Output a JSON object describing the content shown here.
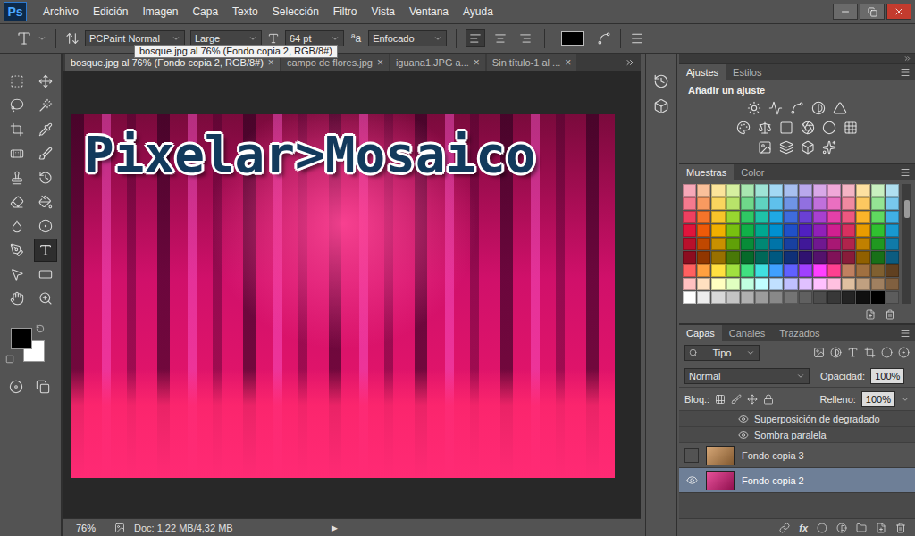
{
  "app": {
    "logo": "Ps"
  },
  "menu": [
    "Archivo",
    "Edición",
    "Imagen",
    "Capa",
    "Texto",
    "Selección",
    "Filtro",
    "Vista",
    "Ventana",
    "Ayuda"
  ],
  "options_bar": {
    "font_family": "PCPaint Normal",
    "font_style": "Large",
    "font_size": "64 pt",
    "antialias_icon": "ªa",
    "antialias": "Enfocado",
    "alignment": [
      {
        "selected": true
      },
      {
        "selected": false
      },
      {
        "selected": false
      }
    ],
    "text_color": "#000000"
  },
  "tooltip": "bosque.jpg al 76% (Fondo copia 2, RGB/8#)",
  "document_tabs": [
    {
      "label": "bosque.jpg al 76% (Fondo copia 2, RGB/8#)",
      "selected": true
    },
    {
      "label": "campo de flores.jpg",
      "selected": false
    },
    {
      "label": "iguana1.JPG a...",
      "selected": false
    },
    {
      "label": "Sin título-1 al ...",
      "selected": false
    }
  ],
  "tab_close": "×",
  "tools": [
    {
      "selected": false
    },
    {
      "selected": false
    },
    {
      "selected": false
    },
    {
      "selected": false
    },
    {
      "selected": false
    },
    {
      "selected": false
    },
    {
      "selected": false
    },
    {
      "selected": false
    },
    {
      "selected": false
    },
    {
      "selected": false
    },
    {
      "selected": false
    },
    {
      "selected": false
    },
    {
      "selected": false
    },
    {
      "selected": false
    },
    {
      "selected": false
    },
    {
      "selected": true
    },
    {
      "selected": false
    },
    {
      "selected": false
    },
    {
      "selected": false
    },
    {
      "selected": false
    }
  ],
  "colors": {
    "foreground": "#000000",
    "background": "#ffffff"
  },
  "canvas": {
    "text": "Pixelar>Mosaico"
  },
  "status_bar": {
    "zoom": "76%",
    "doc": "Doc: 1,22 MB/4,32 MB",
    "arrow": "▶"
  },
  "panels": {
    "adjustments": {
      "tabs": [
        {
          "label": "Ajustes",
          "selected": true
        },
        {
          "label": "Estilos",
          "selected": false
        }
      ],
      "title": "Añadir un ajuste"
    },
    "swatches": {
      "tabs": [
        {
          "label": "Muestras",
          "selected": true
        },
        {
          "label": "Color",
          "selected": false
        }
      ],
      "colors": [
        [
          "#f7a8b8",
          "#f9c09a",
          "#fbe49a",
          "#d6f0a0",
          "#a8e6b0",
          "#9fe3d6",
          "#a3d8f4",
          "#a8bff0",
          "#b9a8ec",
          "#d8a8e8",
          "#f0a8d8",
          "#f4b4c4",
          "#fde0a0",
          "#c8f0c0",
          "#b0e0f0"
        ],
        [
          "#f47a8e",
          "#f89a60",
          "#f9d55e",
          "#b8e36a",
          "#6fd88a",
          "#5fd3c0",
          "#5fc0ec",
          "#6f94e6",
          "#9170e0",
          "#c070dc",
          "#ea6fc0",
          "#f08aa0",
          "#fcc860",
          "#94e494",
          "#78c8ec"
        ],
        [
          "#ef4060",
          "#f6742a",
          "#f7c52a",
          "#98d630",
          "#2fc864",
          "#1fc2a8",
          "#1fa8e4",
          "#3f6cdc",
          "#6a40d4",
          "#a840d0",
          "#e440a8",
          "#ec5880",
          "#fab42a",
          "#60d860",
          "#40b0e4"
        ],
        [
          "#e0143c",
          "#ee5a08",
          "#f0b000",
          "#78c010",
          "#10b048",
          "#00a890",
          "#0090d0",
          "#2050c8",
          "#5020c0",
          "#9020b8",
          "#d02090",
          "#d83060",
          "#e89c00",
          "#30c030",
          "#1898d0"
        ],
        [
          "#b8102c",
          "#c04800",
          "#c89000",
          "#60a008",
          "#088c38",
          "#008874",
          "#0074a8",
          "#1840a0",
          "#401898",
          "#701890",
          "#a81874",
          "#b0244c",
          "#c08000",
          "#209820",
          "#107aa8"
        ],
        [
          "#8c0c20",
          "#903600",
          "#987000",
          "#487808",
          "#066a2a",
          "#006858",
          "#005880",
          "#103078",
          "#301270",
          "#54126c",
          "#801258",
          "#881c3a",
          "#906000",
          "#187018",
          "#0c5c80"
        ],
        [
          "#ff6060",
          "#ffa040",
          "#ffe040",
          "#a0e040",
          "#40e080",
          "#40e0e0",
          "#40a0ff",
          "#6060ff",
          "#a040ff",
          "#ff40ff",
          "#ff4090",
          "#c08060",
          "#a07040",
          "#806030",
          "#604020"
        ],
        [
          "#ffc0c0",
          "#ffe0c0",
          "#ffffc0",
          "#e0ffc0",
          "#c0ffe0",
          "#c0ffff",
          "#c0e0ff",
          "#c0c0ff",
          "#e0c0ff",
          "#ffc0ff",
          "#ffc0e0",
          "#e0c0a0",
          "#c0a080",
          "#a08060",
          "#806040"
        ],
        [
          "#ffffff",
          "#ececec",
          "#d8d8d8",
          "#c4c4c4",
          "#b0b0b0",
          "#9c9c9c",
          "#888888",
          "#747474",
          "#606060",
          "#4c4c4c",
          "#383838",
          "#242424",
          "#101010",
          "#000000",
          "#5c5c5c"
        ]
      ]
    },
    "layers": {
      "tabs": [
        {
          "label": "Capas",
          "selected": true
        },
        {
          "label": "Canales",
          "selected": false
        },
        {
          "label": "Trazados",
          "selected": false
        }
      ],
      "filter": "Tipo",
      "blend_mode": "Normal",
      "opacity_label": "Opacidad:",
      "opacity": "100%",
      "lock_label": "Bloq.:",
      "fill_label": "Relleno:",
      "fill": "100%",
      "fx": "fx",
      "items": [
        {
          "kind": "effect",
          "name": "Superposición de degradado",
          "visible": true,
          "selected": false
        },
        {
          "kind": "effect",
          "name": "Sombra paralela",
          "visible": true,
          "selected": false
        },
        {
          "kind": "layer",
          "name": "Fondo copia 3",
          "visible": false,
          "selected": false,
          "color": "#c98a4a"
        },
        {
          "kind": "layer",
          "name": "Fondo copia 2",
          "visible": true,
          "selected": true,
          "color": "#e0197a"
        }
      ]
    }
  }
}
